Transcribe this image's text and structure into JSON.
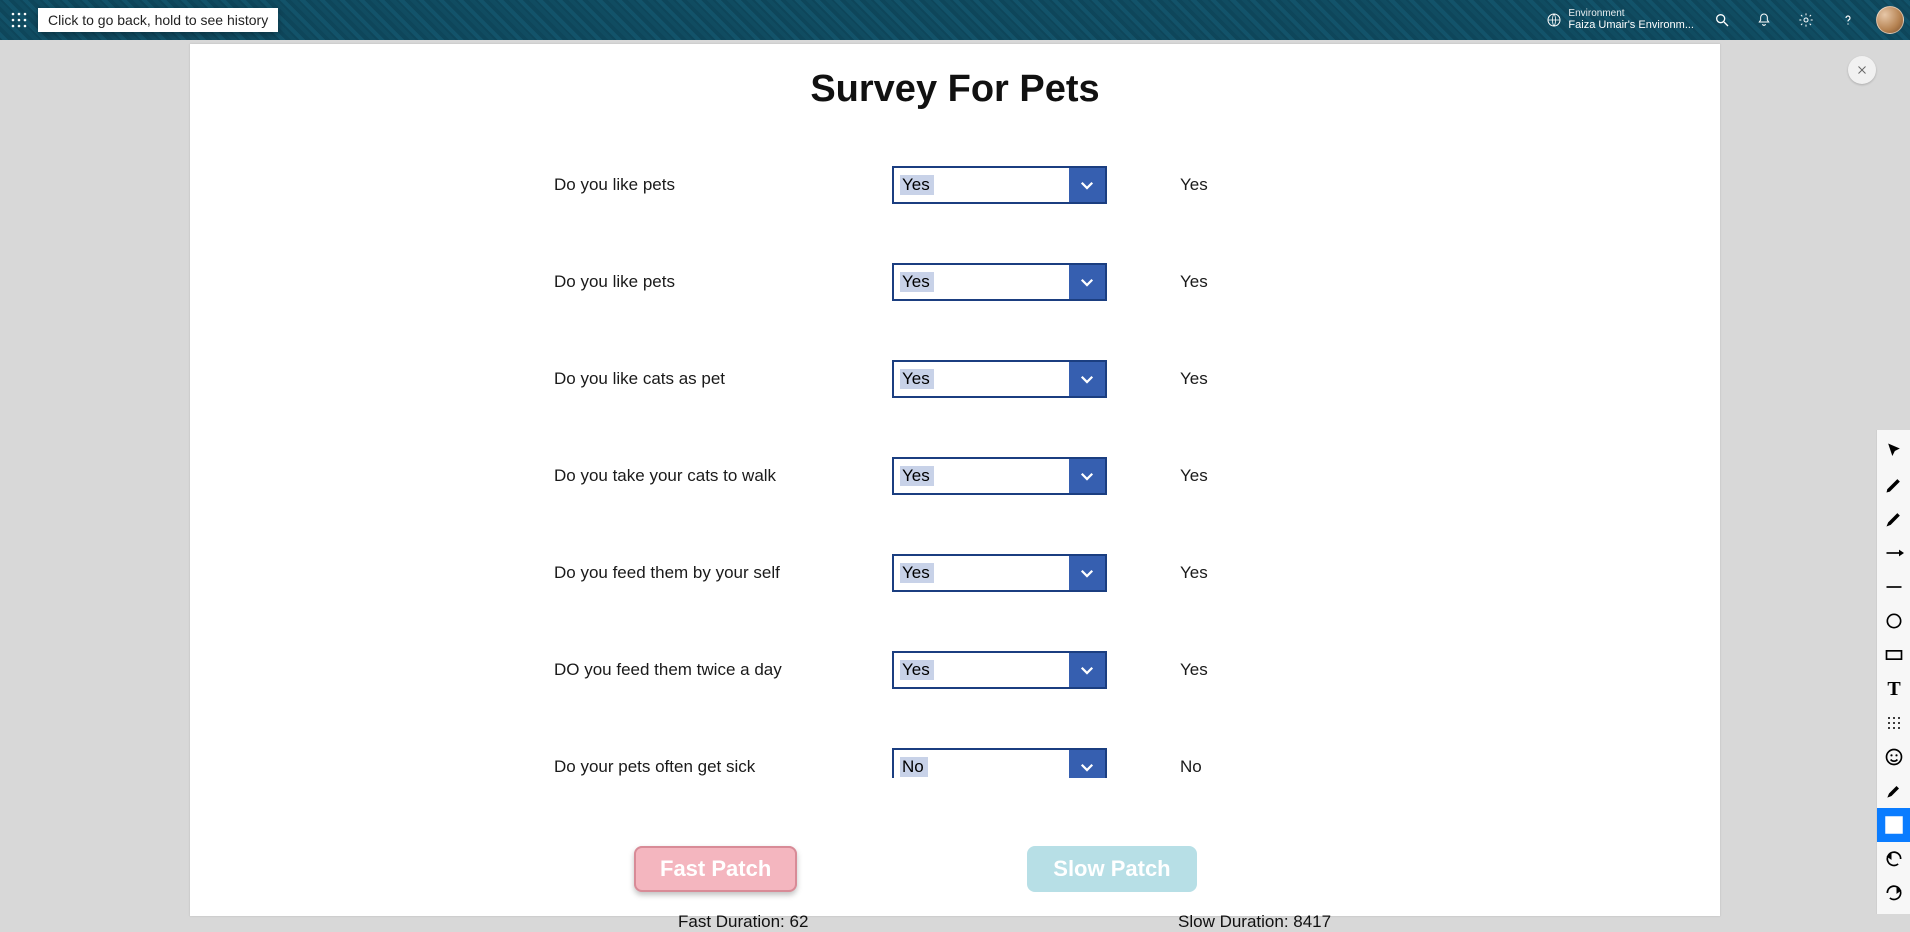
{
  "header": {
    "back_tooltip": "Click to go back, hold to see history",
    "env_label": "Environment",
    "env_name": "Faiza Umair's Environm..."
  },
  "page": {
    "title": "Survey For Pets"
  },
  "questions": [
    {
      "label": "Do you like pets",
      "value": "Yes",
      "answer": "Yes"
    },
    {
      "label": "Do you like pets",
      "value": "Yes",
      "answer": "Yes"
    },
    {
      "label": "Do you like cats as pet",
      "value": "Yes",
      "answer": "Yes"
    },
    {
      "label": "Do you take your cats to walk",
      "value": "Yes",
      "answer": "Yes"
    },
    {
      "label": "Do you feed them by your self",
      "value": "Yes",
      "answer": "Yes"
    },
    {
      "label": "DO you feed them twice a  day",
      "value": "Yes",
      "answer": "Yes"
    },
    {
      "label": "Do your pets often get sick",
      "value": "No",
      "answer": "No"
    }
  ],
  "buttons": {
    "fast_label": "Fast Patch",
    "slow_label": "Slow Patch"
  },
  "durations": {
    "fast": "Fast Duration: 62",
    "slow": "Slow Duration: 8417"
  },
  "toolbox": {
    "text_tool_glyph": "T"
  }
}
